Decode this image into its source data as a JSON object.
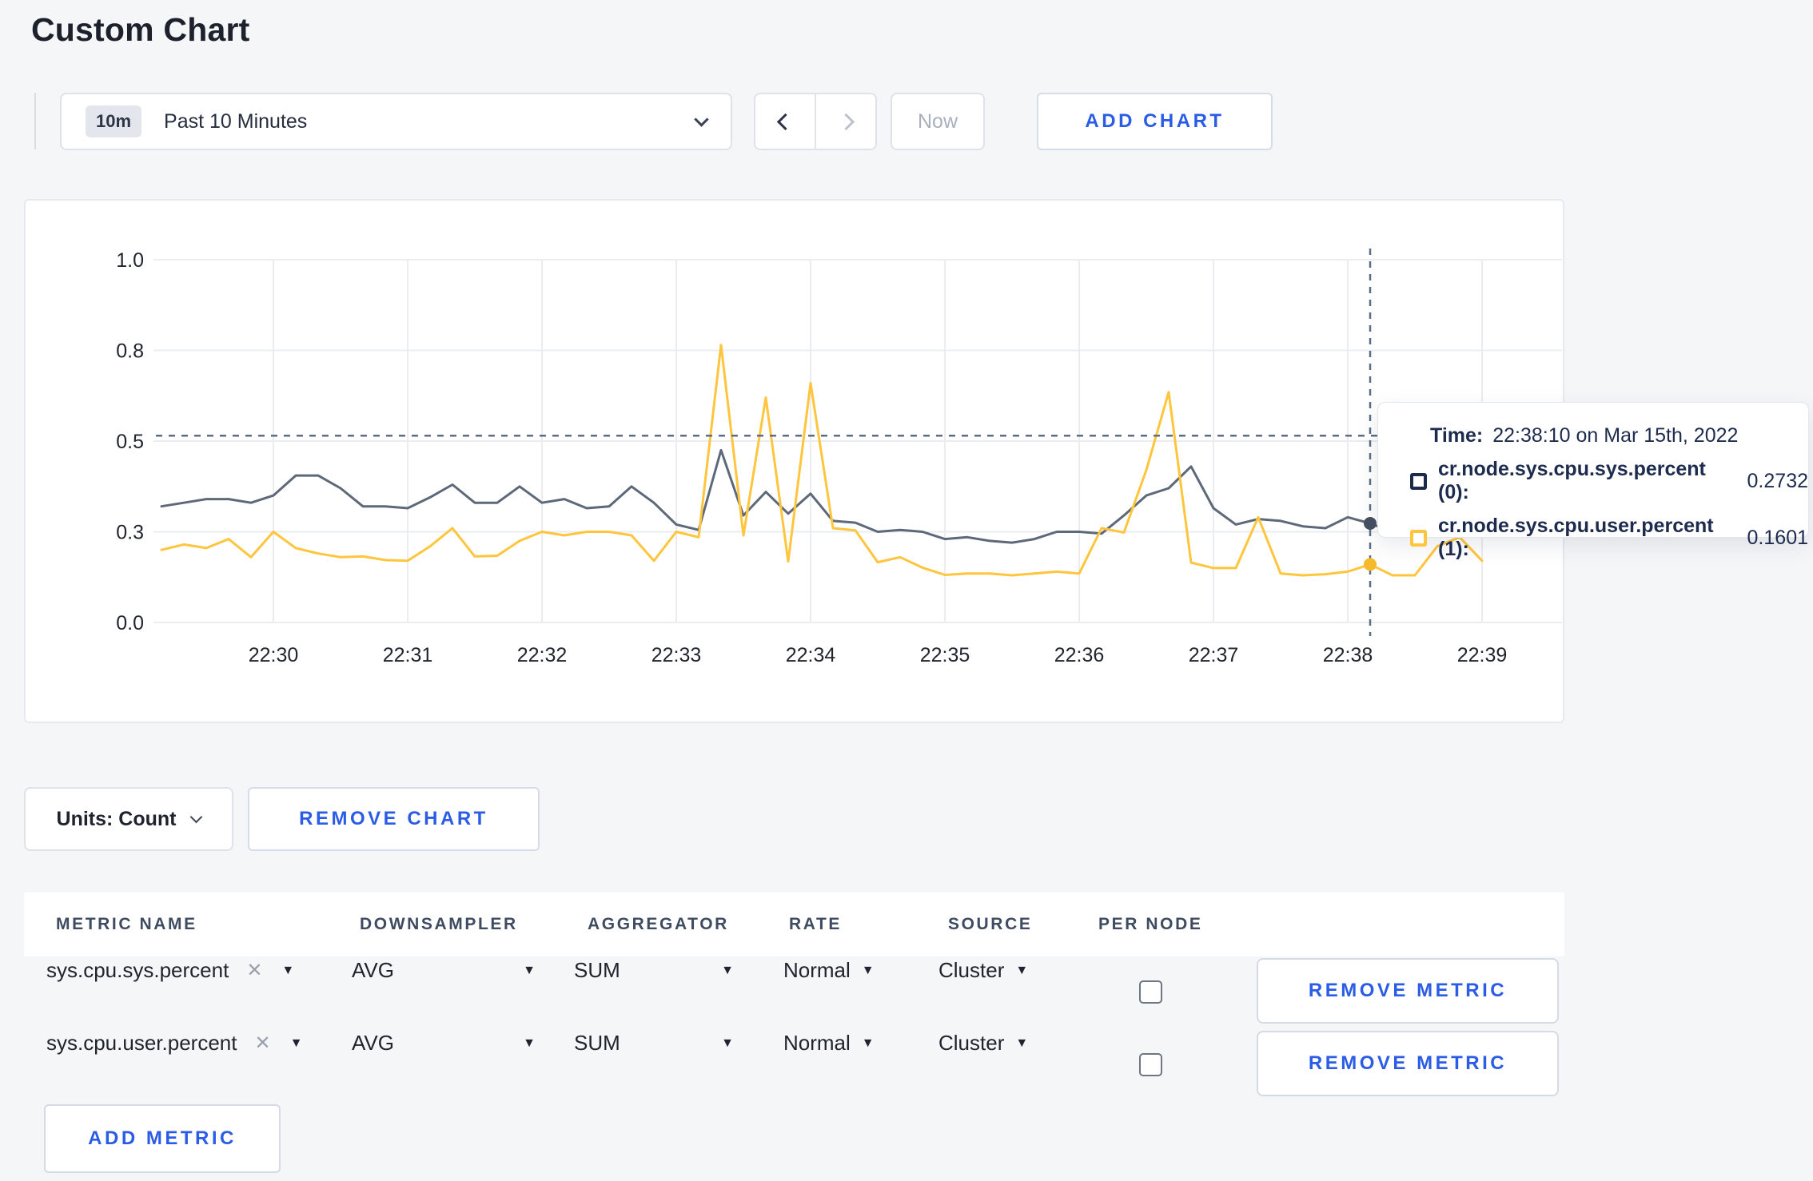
{
  "page": {
    "title": "Custom Chart"
  },
  "toolbar": {
    "time_range": {
      "badge": "10m",
      "label": "Past 10 Minutes"
    },
    "now_label": "Now",
    "add_chart_label": "ADD CHART"
  },
  "chart_data": {
    "type": "line",
    "title": "",
    "xlabel": "",
    "ylabel": "",
    "grid": true,
    "x_axis": {
      "tick_labels": [
        "22:30",
        "22:31",
        "22:32",
        "22:33",
        "22:34",
        "22:35",
        "22:36",
        "22:37",
        "22:38",
        "22:39"
      ]
    },
    "y_axis": {
      "ticks": [
        {
          "label": "1.0",
          "value": 1.0
        },
        {
          "label": "0.8",
          "value": 0.75
        },
        {
          "label": "0.5",
          "value": 0.5
        },
        {
          "label": "0.3",
          "value": 0.25
        },
        {
          "label": "0.0",
          "value": 0.0
        }
      ],
      "ylim": [
        0,
        1
      ]
    },
    "start_time": "22:29:10",
    "interval_seconds": 10,
    "series": [
      {
        "name": "cr.node.sys.cpu.sys.percent",
        "color": "#5d6878",
        "marker_color": "#465062",
        "values": [
          0.32,
          0.33,
          0.34,
          0.34,
          0.33,
          0.35,
          0.405,
          0.405,
          0.37,
          0.32,
          0.32,
          0.315,
          0.345,
          0.38,
          0.33,
          0.33,
          0.375,
          0.33,
          0.34,
          0.315,
          0.32,
          0.375,
          0.33,
          0.27,
          0.255,
          0.475,
          0.295,
          0.36,
          0.3,
          0.355,
          0.28,
          0.275,
          0.25,
          0.255,
          0.25,
          0.23,
          0.235,
          0.225,
          0.22,
          0.23,
          0.25,
          0.25,
          0.245,
          0.295,
          0.35,
          0.37,
          0.43,
          0.315,
          0.27,
          0.285,
          0.28,
          0.265,
          0.26,
          0.29,
          0.2732,
          0.25,
          0.27,
          0.28,
          0.29,
          0.28
        ]
      },
      {
        "name": "cr.node.sys.cpu.user.percent",
        "color": "#ffc53d",
        "marker_color": "#f5b92c",
        "values": [
          0.2,
          0.215,
          0.205,
          0.23,
          0.18,
          0.25,
          0.205,
          0.19,
          0.18,
          0.182,
          0.172,
          0.17,
          0.21,
          0.26,
          0.182,
          0.184,
          0.225,
          0.25,
          0.24,
          0.25,
          0.25,
          0.24,
          0.17,
          0.25,
          0.235,
          0.765,
          0.24,
          0.62,
          0.168,
          0.66,
          0.26,
          0.254,
          0.166,
          0.18,
          0.151,
          0.131,
          0.135,
          0.135,
          0.13,
          0.135,
          0.14,
          0.135,
          0.26,
          0.248,
          0.42,
          0.635,
          0.165,
          0.15,
          0.15,
          0.29,
          0.135,
          0.13,
          0.133,
          0.14,
          0.1601,
          0.13,
          0.13,
          0.21,
          0.235,
          0.17
        ]
      }
    ],
    "cursor": {
      "index": 54,
      "hline_value": 0.515,
      "color": "#5b6e87"
    }
  },
  "tooltip": {
    "time_label": "Time:",
    "time_value": "22:38:10 on Mar 15th, 2022",
    "rows": [
      {
        "name": "cr.node.sys.cpu.sys.percent (0):",
        "value": "0.2732",
        "color": "#1c2b4a"
      },
      {
        "name": "cr.node.sys.cpu.user.percent (1):",
        "value": "0.1601",
        "color": "#ffc53d"
      }
    ]
  },
  "chart_footer": {
    "units_label": "Units: Count",
    "remove_chart_label": "REMOVE CHART"
  },
  "metrics_table": {
    "headers": [
      "METRIC NAME",
      "DOWNSAMPLER",
      "AGGREGATOR",
      "RATE",
      "SOURCE",
      "PER NODE"
    ],
    "rows": [
      {
        "metric": "sys.cpu.sys.percent",
        "downsampler": "AVG",
        "aggregator": "SUM",
        "rate": "Normal",
        "source": "Cluster",
        "per_node_checked": false
      },
      {
        "metric": "sys.cpu.user.percent",
        "downsampler": "AVG",
        "aggregator": "SUM",
        "rate": "Normal",
        "source": "Cluster",
        "per_node_checked": false
      }
    ],
    "remove_metric_label": "REMOVE METRIC",
    "add_metric_label": "ADD METRIC"
  }
}
